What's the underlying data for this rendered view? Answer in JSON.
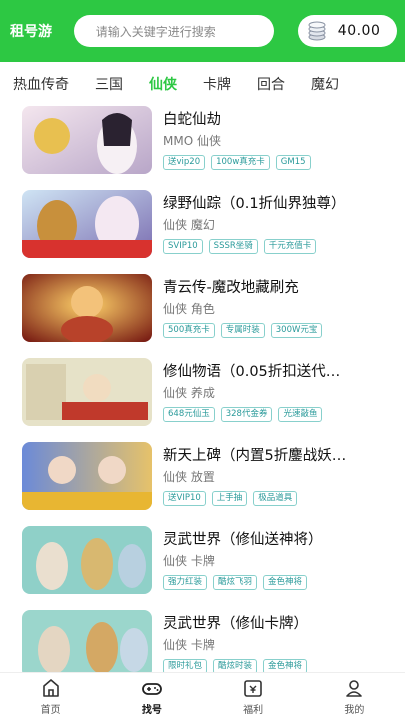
{
  "header": {
    "brand": "租号游",
    "search_placeholder": "请输入关键字进行搜索",
    "coins": "40.00"
  },
  "tabs": [
    {
      "label": "热血传奇"
    },
    {
      "label": "三国"
    },
    {
      "label": "仙侠"
    },
    {
      "label": "卡牌"
    },
    {
      "label": "回合"
    },
    {
      "label": "魔幻"
    }
  ],
  "games": [
    {
      "title": "白蛇仙劫",
      "sub": "MMO 仙侠",
      "tags": [
        "送vip20",
        "100w真充卡",
        "GM15"
      ]
    },
    {
      "title": "绿野仙踪（0.1折仙界独尊）",
      "sub": "仙侠 魔幻",
      "tags": [
        "SVIP10",
        "SSSR坐骑",
        "千元充值卡"
      ]
    },
    {
      "title": "青云传-魔改地藏刷充",
      "sub": "仙侠 角色",
      "tags": [
        "500真充卡",
        "专属时装",
        "300W元宝"
      ]
    },
    {
      "title": "修仙物语（0.05折扣送代…",
      "sub": "仙侠 养成",
      "tags": [
        "648元仙玉",
        "328代金券",
        "光速敲鱼"
      ]
    },
    {
      "title": "新天上碑（内置5折鏖战妖…",
      "sub": "仙侠 放置",
      "tags": [
        "送VIP10",
        "上手抽",
        "极品道具"
      ]
    },
    {
      "title": "灵武世界（修仙送神将）",
      "sub": "仙侠 卡牌",
      "tags": [
        "强力红装",
        "酷炫飞羽",
        "金色神将"
      ]
    },
    {
      "title": "灵武世界（修仙卡牌）",
      "sub": "仙侠 卡牌",
      "tags": [
        "限时礼包",
        "酷炫时装",
        "金色神将"
      ]
    }
  ],
  "nav": [
    {
      "label": "首页"
    },
    {
      "label": "找号"
    },
    {
      "label": "福利"
    },
    {
      "label": "我的"
    }
  ],
  "colors": {
    "brand_green": "#2dc843",
    "tag": "#2a9a9a"
  }
}
